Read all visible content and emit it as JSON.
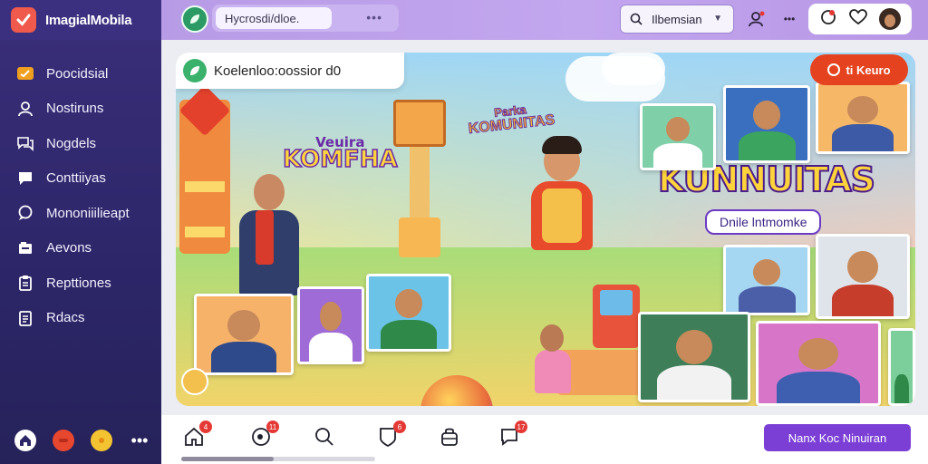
{
  "app": {
    "title": "ImagialMobila"
  },
  "sidebar": {
    "items": [
      {
        "label": "Poocidsial",
        "icon": "folder-icon",
        "color": "#f0a020"
      },
      {
        "label": "Nostiruns",
        "icon": "user-icon",
        "color": "#ffffff"
      },
      {
        "label": "Nogdels",
        "icon": "chat-bubbles-icon",
        "color": "#ffffff"
      },
      {
        "label": "Conttiiyas",
        "icon": "message-icon",
        "color": "#ffffff"
      },
      {
        "label": "Mononiiilieapt",
        "icon": "comment-icon",
        "color": "#ffffff"
      },
      {
        "label": "Aevons",
        "icon": "inbox-icon",
        "color": "#ffffff"
      },
      {
        "label": "Repttiones",
        "icon": "clipboard-icon",
        "color": "#ffffff"
      },
      {
        "label": "Rdacs",
        "icon": "document-icon",
        "color": "#ffffff"
      }
    ],
    "footer": [
      "home-icon",
      "record-icon",
      "coin-icon",
      "more-icon"
    ]
  },
  "topbar": {
    "search_value": "Hycrosdi/dloe.",
    "select_value": "Ilbemsian",
    "icons": [
      "profile-notify-icon",
      "more-dots-icon",
      "notification-icon",
      "heart-icon",
      "avatar"
    ]
  },
  "banner": {
    "caption": "Koelenloo:oossior d0",
    "live_badge": "ti Keuro",
    "title_left_small": "Veuira",
    "title_left": "KOMFHA",
    "title_mid_small": "Parka",
    "title_mid": "KOMUNITAS",
    "title_right": "KUNNUITAS",
    "title_right_sub": "Dnile lntmomke"
  },
  "bottombar": {
    "icons": [
      {
        "name": "home-icon",
        "badge": "4"
      },
      {
        "name": "clock-icon",
        "badge": "11"
      },
      {
        "name": "search-icon",
        "badge": ""
      },
      {
        "name": "shield-icon",
        "badge": "6"
      },
      {
        "name": "bag-icon",
        "badge": ""
      },
      {
        "name": "chat-icon",
        "badge": "17"
      }
    ],
    "cta_label": "Nanx Koc Ninuiran"
  },
  "colors": {
    "accent": "#7b3fd6",
    "sidebar": "#2c2668",
    "badge": "#e53935"
  }
}
